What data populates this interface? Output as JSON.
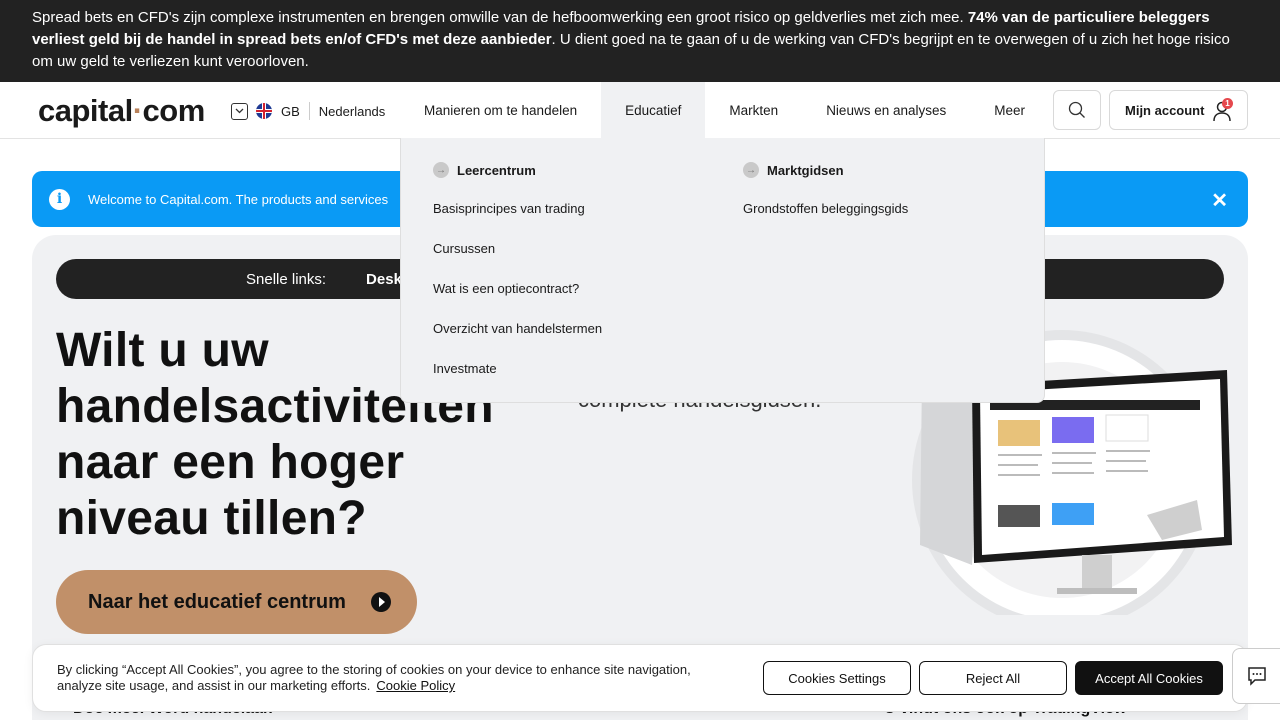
{
  "risk_banner": {
    "text_normal_1": "Spread bets en CFD's zijn complexe instrumenten en brengen omwille van de hefboomwerking een groot risico op geldverlies met zich mee. ",
    "text_bold": "74% van de particuliere beleggers verliest geld bij de handel in spread bets en/of CFD's met deze aanbieder",
    "text_normal_2": ". U dient goed na te gaan of u de werking van CFD's begrijpt en te overwegen of u zich het hoge risico om uw geld te verliezen kunt veroorloven."
  },
  "header": {
    "logo_part1": "capital",
    "logo_dot": "·",
    "logo_part2": "com",
    "region": "GB",
    "language": "Nederlands",
    "nav": [
      "Manieren om te handelen",
      "Educatief",
      "Markten",
      "Nieuws en analyses",
      "Meer"
    ],
    "account_label": "Mijn account",
    "account_badge": "1"
  },
  "info_banner": {
    "icon_name": "info-icon",
    "text": "Welcome to Capital.com. The products and services"
  },
  "dropdown": {
    "col1_title": "Leercentrum",
    "col1_links": [
      "Basisprincipes van trading",
      "Cursussen",
      "Wat is een optiecontract?",
      "Overzicht van handelstermen",
      "Investmate"
    ],
    "col2_title": "Marktgidsen",
    "col2_links": [
      "Grondstoffen beleggingsgids"
    ]
  },
  "hero": {
    "quick_links_label": "Snelle links:",
    "quick_link_1": "Desk",
    "title": "Wilt u uw handelsactiviteiten naar een hoger niveau tillen?",
    "subtitle": "complete handelsgidsen.",
    "cta": "Naar het educatief centrum"
  },
  "bottom_strip": {
    "left": "Doe mee. Word handelaar.",
    "right": "U vindt ons ook op TradingView"
  },
  "cookie": {
    "text": "By clicking “Accept All Cookies”, you agree to the storing of cookies on your device to enhance site navigation, analyze site usage, and assist in our marketing efforts.",
    "policy_link": "Cookie Policy",
    "settings": "Cookies Settings",
    "reject": "Reject All",
    "accept": "Accept All Cookies"
  },
  "colors": {
    "brand_accent": "#b9825b",
    "cta_bg": "#c19069",
    "info_blue": "#0a9af5",
    "dark": "#222222"
  }
}
